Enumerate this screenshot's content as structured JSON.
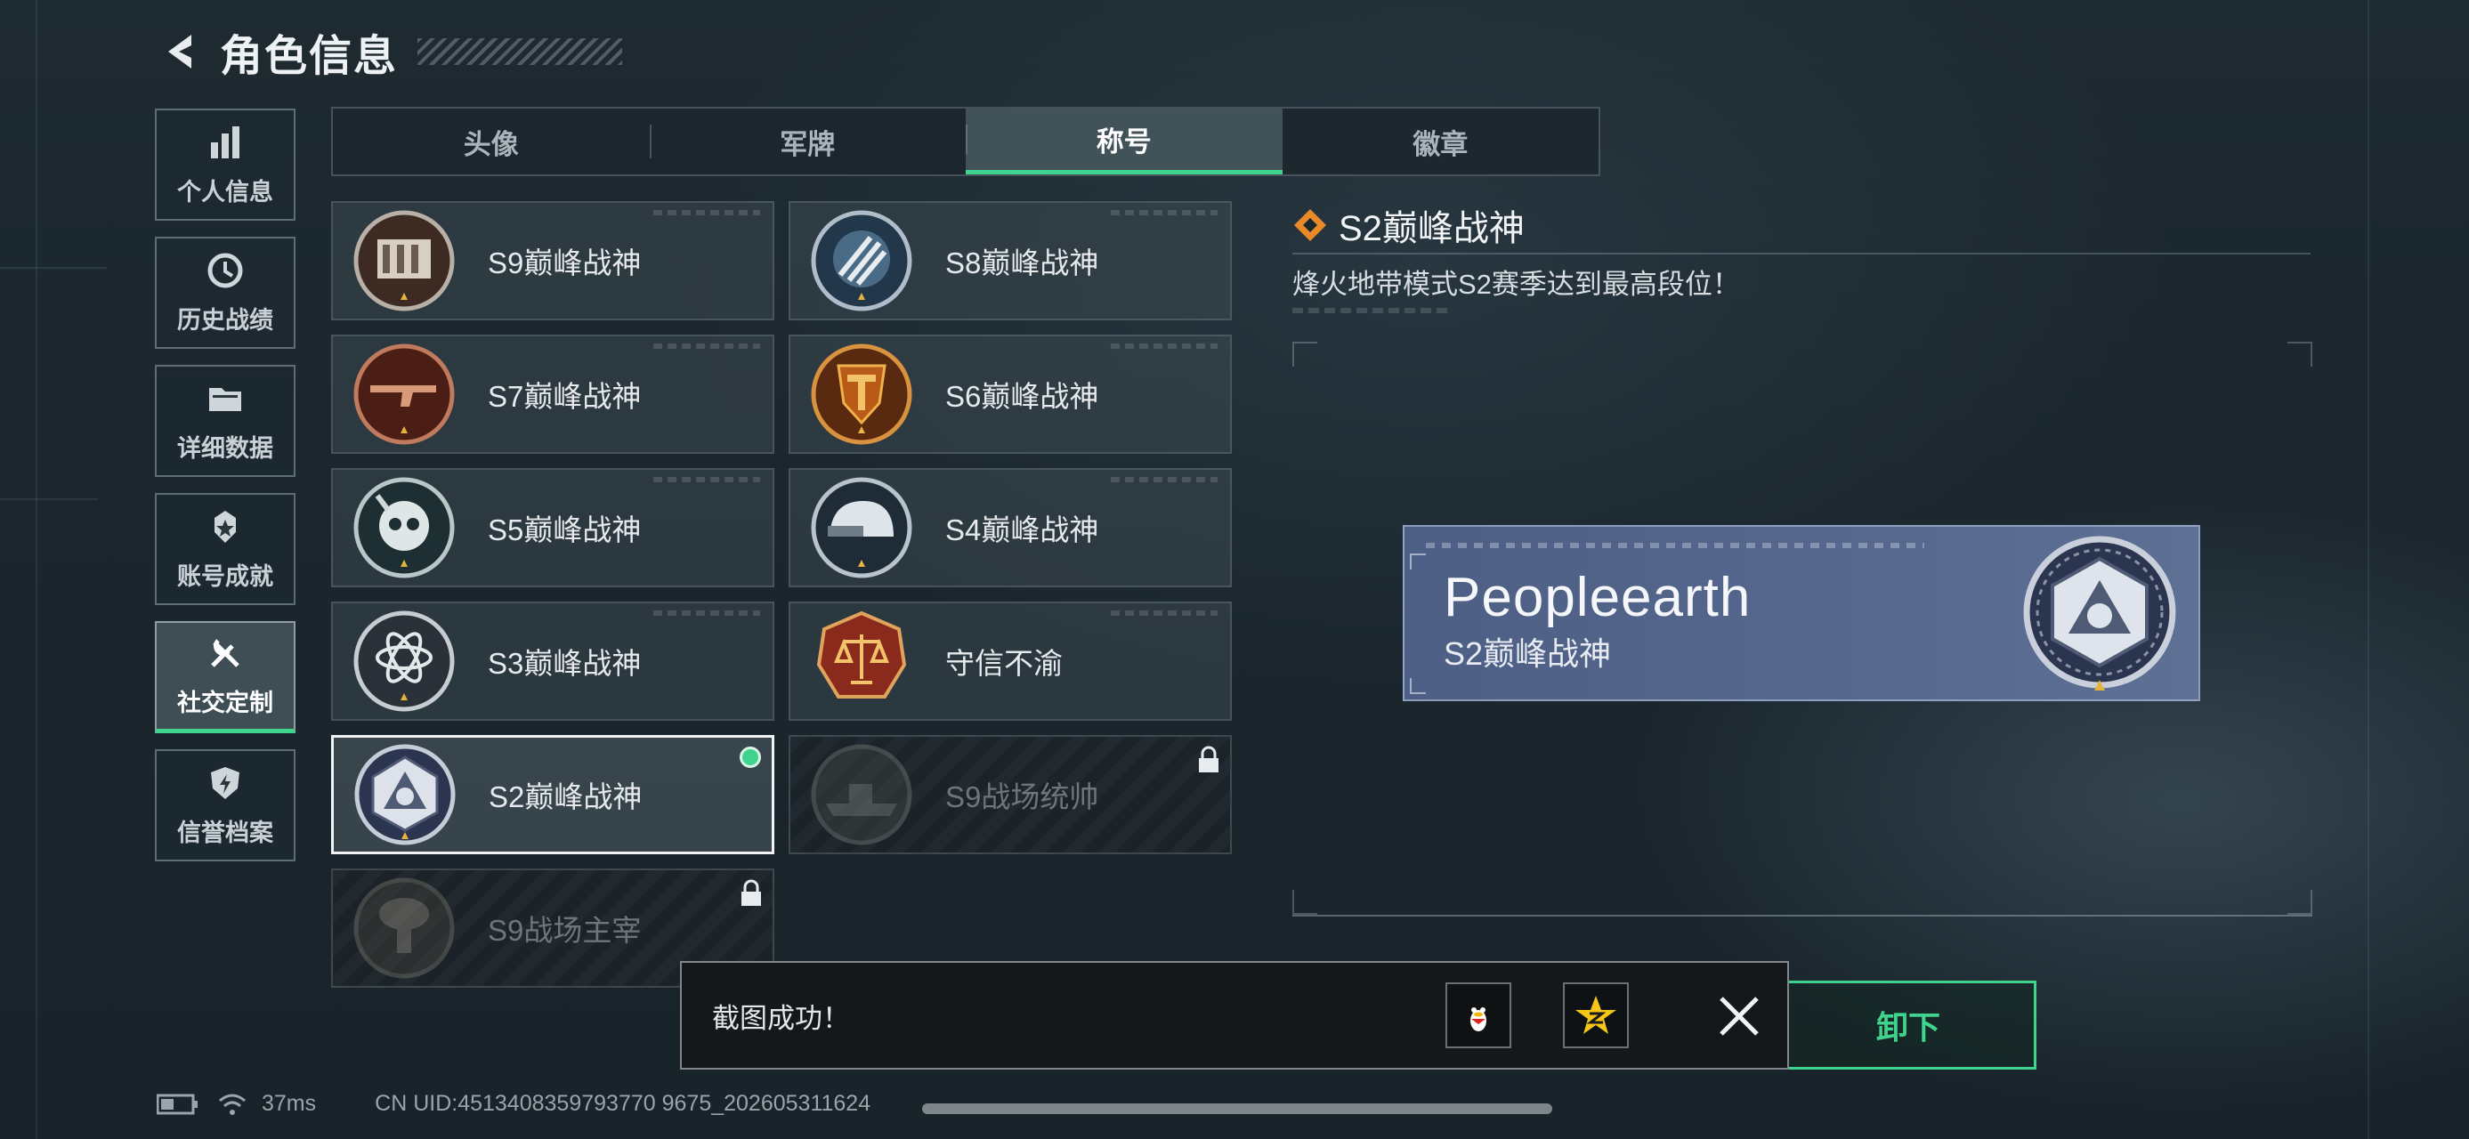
{
  "header": {
    "title": "角色信息",
    "back_icon": "back-arrow-icon"
  },
  "sidebar": {
    "items": [
      {
        "label": "个人信息",
        "icon": "bar-chart-icon",
        "active": false
      },
      {
        "label": "历史战绩",
        "icon": "history-clock-icon",
        "active": false
      },
      {
        "label": "详细数据",
        "icon": "folder-icon",
        "active": false
      },
      {
        "label": "账号成就",
        "icon": "medal-icon",
        "active": false
      },
      {
        "label": "社交定制",
        "icon": "tools-icon",
        "active": true
      },
      {
        "label": "信誉档案",
        "icon": "shield-icon",
        "active": false
      }
    ]
  },
  "tabs": [
    {
      "label": "头像",
      "active": false
    },
    {
      "label": "军牌",
      "active": false
    },
    {
      "label": "称号",
      "active": true
    },
    {
      "label": "徽章",
      "active": false
    }
  ],
  "titles": [
    {
      "name": "S9巅峰战神",
      "emblem": "wall-emblem-icon",
      "state": "unlocked"
    },
    {
      "name": "S8巅峰战神",
      "emblem": "stripes-emblem-icon",
      "state": "unlocked"
    },
    {
      "name": "S7巅峰战神",
      "emblem": "rifle-emblem-icon",
      "state": "unlocked"
    },
    {
      "name": "S6巅峰战神",
      "emblem": "t-shield-emblem-icon",
      "state": "unlocked"
    },
    {
      "name": "S5巅峰战神",
      "emblem": "diver-skull-emblem-icon",
      "state": "unlocked"
    },
    {
      "name": "S4巅峰战神",
      "emblem": "helmet-emblem-icon",
      "state": "unlocked"
    },
    {
      "name": "S3巅峰战神",
      "emblem": "atom-emblem-icon",
      "state": "unlocked"
    },
    {
      "name": "守信不渝",
      "emblem": "scales-emblem-icon",
      "state": "unlocked"
    },
    {
      "name": "S2巅峰战神",
      "emblem": "triangle-r-emblem-icon",
      "state": "equipped"
    },
    {
      "name": "S9战场统帅",
      "emblem": "warship-emblem-icon",
      "state": "locked"
    },
    {
      "name": "S9战场主宰",
      "emblem": "mushroom-cloud-emblem-icon",
      "state": "locked"
    }
  ],
  "detail": {
    "title": "S2巅峰战神",
    "description": "烽火地带模式S2赛季达到最高段位！",
    "title_icon": "diamond-badge-icon"
  },
  "nameplate": {
    "player_name": "Peopleearth",
    "title": "S2巅峰战神",
    "emblem": "triangle-r-emblem-icon"
  },
  "equip_button": {
    "label": "卸下"
  },
  "toast": {
    "message": "截图成功！",
    "share_targets": [
      "qq-penguin-icon",
      "qzone-star-icon"
    ],
    "close_icon": "close-icon"
  },
  "status_bar": {
    "ping": "37ms",
    "uid": "CN UID:4513408359793770 9675_202605311624"
  },
  "colors": {
    "accent": "#3fd48e",
    "nameplate": "#56688e",
    "background": "#1b262d"
  }
}
